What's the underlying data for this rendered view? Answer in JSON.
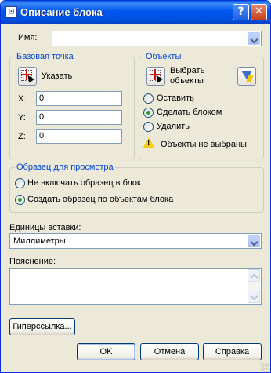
{
  "window": {
    "title": "Описание блока",
    "help_button": "?",
    "close_button": "✕"
  },
  "name": {
    "label": "Имя:",
    "value": ""
  },
  "base_point": {
    "title": "Базовая точка",
    "pick_label": "Указать",
    "x_label": "X:",
    "x_value": "0",
    "y_label": "Y:",
    "y_value": "0",
    "z_label": "Z:",
    "z_value": "0"
  },
  "objects": {
    "title": "Объекты",
    "select_label_1": "Выбрать",
    "select_label_2": "объекты",
    "options": [
      "Оставить",
      "Сделать блоком",
      "Удалить"
    ],
    "selected_index": 1,
    "warning_text": "Объекты не выбраны"
  },
  "preview": {
    "title": "Образец для просмотра",
    "options": [
      "Не включать образец в блок",
      "Создать образец по объектам блока"
    ],
    "selected_index": 1
  },
  "units": {
    "label": "Единицы вставки:",
    "value": "Миллиметры"
  },
  "description": {
    "label": "Пояснение:",
    "value": ""
  },
  "buttons": {
    "hyperlink": "Гиперссылка...",
    "ok": "OK",
    "cancel": "Отмена",
    "help": "Справка"
  },
  "colors": {
    "title_bar": "#0058ee",
    "dialog_bg": "#ece9d8",
    "group_title": "#0046d5",
    "warning": "#f6cf12"
  }
}
